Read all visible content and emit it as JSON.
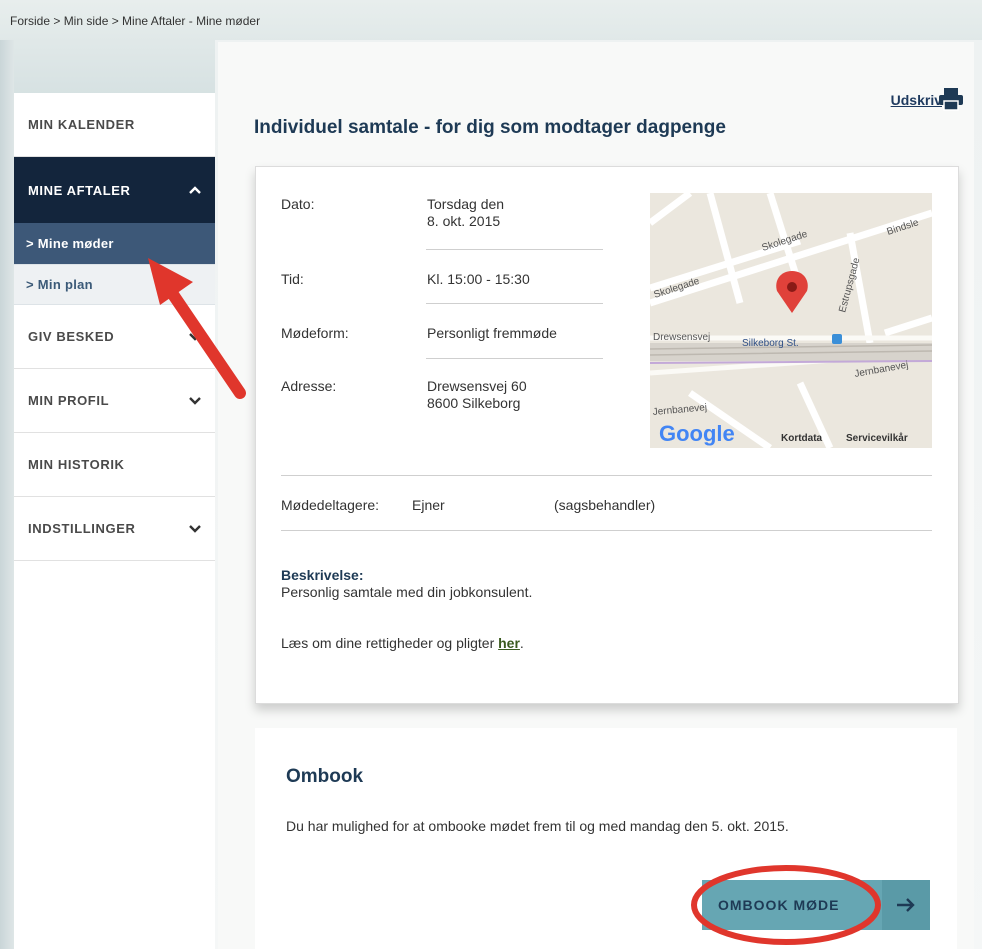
{
  "breadcrumb": "Forside > Min side > Mine Aftaler - Mine møder",
  "sidebar": {
    "items": [
      {
        "label": "MIN KALENDER"
      },
      {
        "label": "MINE AFTALER"
      },
      {
        "label": "GIV BESKED"
      },
      {
        "label": "MIN PROFIL"
      },
      {
        "label": "MIN HISTORIK"
      },
      {
        "label": "INDSTILLINGER"
      }
    ],
    "subitems": [
      {
        "label": "> Mine møder"
      },
      {
        "label": "> Min plan"
      }
    ]
  },
  "header": {
    "print_label": "Udskriv",
    "title": "Individuel samtale - for dig som modtager dagpenge"
  },
  "details": {
    "dato_label": "Dato:",
    "dato_line1": "Torsdag den",
    "dato_line2": "8. okt. 2015",
    "tid_label": "Tid:",
    "tid_value": "Kl. 15:00 - 15:30",
    "modeform_label": "Mødeform:",
    "modeform_value": "Personligt fremmøde",
    "adresse_label": "Adresse:",
    "adresse_line1": "Drewsensvej 60",
    "adresse_line2": "8600 Silkeborg",
    "deltagere_label": "Mødedeltagere:",
    "deltagere_name": "Ejner",
    "deltagere_role": "(sagsbehandler)",
    "beskrivelse_label": "Beskrivelse:",
    "beskrivelse_text": "Personlig samtale med din jobkonsulent.",
    "rights_text": "Læs om dine rettigheder og pligter ",
    "rights_link": "her",
    "rights_end": "."
  },
  "map": {
    "streets": [
      "Skolegade",
      "Skolegade",
      "Bindsle",
      "Estrupsgade",
      "Drewsensvej",
      "Silkeborg St.",
      "Jernbanevej",
      "Jernbanevej"
    ],
    "logo": "Google",
    "kortdata": "Kortdata",
    "vilkar": "Servicevilkår"
  },
  "ombook": {
    "title": "Ombook",
    "text": "Du har mulighed for at ombooke mødet frem til og med mandag den 5. okt. 2015.",
    "button_label": "OMBOOK MØDE"
  },
  "colors": {
    "nav_active": "#13253c",
    "sub_selected": "#3d5878",
    "button": "#66a6b3",
    "annotation_red": "#e0362c"
  }
}
